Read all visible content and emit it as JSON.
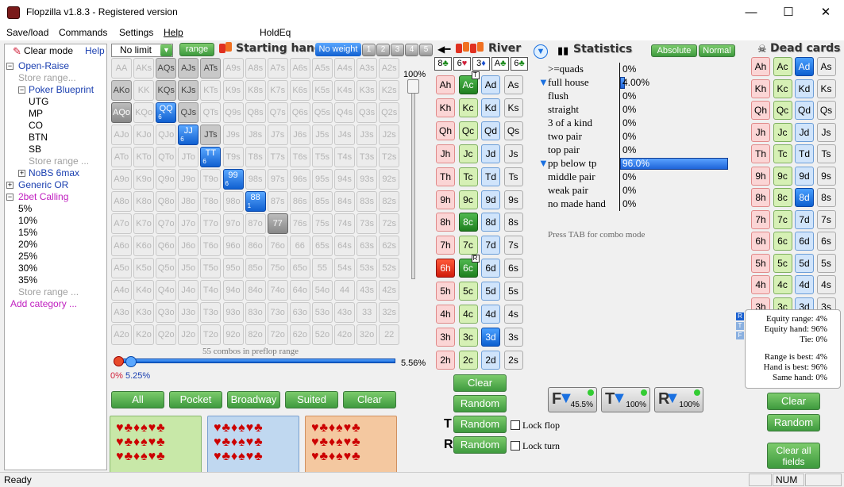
{
  "window": {
    "title": "Flopzilla v1.8.3 - Registered version",
    "minimize": "—",
    "maximize": "☐",
    "close": "✕"
  },
  "menu": [
    "Save/load",
    "Commands",
    "Settings",
    "Help",
    "HoldEq"
  ],
  "tree": {
    "clear_mode": "Clear mode",
    "help": "Help",
    "open_raise": "Open-Raise",
    "store_range": "Store range...",
    "poker_blueprint": "Poker Blueprint",
    "positions": [
      "UTG",
      "MP",
      "CO",
      "BTN",
      "SB"
    ],
    "store_range_2": "Store range ...",
    "nobs": "NoBS 6max",
    "generic_or": "Generic OR",
    "bet_calling": "2bet Calling",
    "percents": [
      "5%",
      "10%",
      "15%",
      "20%",
      "25%",
      "30%",
      "35%"
    ],
    "store_range_3": "Store range ...",
    "add_category": "Add category ..."
  },
  "range_controls": {
    "limit": "No limit",
    "range_btn": "range",
    "starting_hand": "Starting hand",
    "no_weight": "No weight",
    "weights": [
      "1",
      "2",
      "3",
      "4",
      "5"
    ],
    "slider_top": "100%",
    "combos_text": "55 combos in preflop range",
    "pct_low": "0%",
    "pct_mid": "5.25%",
    "pct_right": "5.56%",
    "buttons": [
      "All",
      "Pocket",
      "Broadway",
      "Suited",
      "Clear"
    ]
  },
  "hand_grid": [
    [
      "AA",
      "AKs",
      "AQs",
      "AJs",
      "ATs",
      "A9s",
      "A8s",
      "A7s",
      "A6s",
      "A5s",
      "A4s",
      "A3s",
      "A2s"
    ],
    [
      "AKo",
      "KK",
      "KQs",
      "KJs",
      "KTs",
      "K9s",
      "K8s",
      "K7s",
      "K6s",
      "K5s",
      "K4s",
      "K3s",
      "K2s"
    ],
    [
      "AQo",
      "KQo",
      "QQ",
      "QJs",
      "QTs",
      "Q9s",
      "Q8s",
      "Q7s",
      "Q6s",
      "Q5s",
      "Q4s",
      "Q3s",
      "Q2s"
    ],
    [
      "AJo",
      "KJo",
      "QJo",
      "JJ",
      "JTs",
      "J9s",
      "J8s",
      "J7s",
      "J6s",
      "J5s",
      "J4s",
      "J3s",
      "J2s"
    ],
    [
      "ATo",
      "KTo",
      "QTo",
      "JTo",
      "TT",
      "T9s",
      "T8s",
      "T7s",
      "T6s",
      "T5s",
      "T4s",
      "T3s",
      "T2s"
    ],
    [
      "A9o",
      "K9o",
      "Q9o",
      "J9o",
      "T9o",
      "99",
      "98s",
      "97s",
      "96s",
      "95s",
      "94s",
      "93s",
      "92s"
    ],
    [
      "A8o",
      "K8o",
      "Q8o",
      "J8o",
      "T8o",
      "98o",
      "88",
      "87s",
      "86s",
      "85s",
      "84s",
      "83s",
      "82s"
    ],
    [
      "A7o",
      "K7o",
      "Q7o",
      "J7o",
      "T7o",
      "97o",
      "87o",
      "77",
      "76s",
      "75s",
      "74s",
      "73s",
      "72s"
    ],
    [
      "A6o",
      "K6o",
      "Q6o",
      "J6o",
      "T6o",
      "96o",
      "86o",
      "76o",
      "66",
      "65s",
      "64s",
      "63s",
      "62s"
    ],
    [
      "A5o",
      "K5o",
      "Q5o",
      "J5o",
      "T5o",
      "95o",
      "85o",
      "75o",
      "65o",
      "55",
      "54s",
      "53s",
      "52s"
    ],
    [
      "A4o",
      "K4o",
      "Q4o",
      "J4o",
      "T4o",
      "94o",
      "84o",
      "74o",
      "64o",
      "54o",
      "44",
      "43s",
      "42s"
    ],
    [
      "A3o",
      "K3o",
      "Q3o",
      "J3o",
      "T3o",
      "93o",
      "83o",
      "73o",
      "63o",
      "53o",
      "43o",
      "33",
      "32s"
    ],
    [
      "A2o",
      "K2o",
      "Q2o",
      "J2o",
      "T2o",
      "92o",
      "82o",
      "72o",
      "62o",
      "52o",
      "42o",
      "32o",
      "22"
    ]
  ],
  "grid_state": {
    "selected": [
      "AQs",
      "AJs",
      "ATs",
      "KQs",
      "KJs",
      "AKo",
      "QJs",
      "JTs"
    ],
    "gray": [
      "AQo",
      "77"
    ],
    "blue": {
      "QQ": "6",
      "JJ": "6",
      "TT": "6",
      "99": "6",
      "88": "1"
    }
  },
  "board": {
    "river_label": "River",
    "filter_labels": [
      "8",
      "6",
      "3",
      "A",
      "6"
    ],
    "ranks": [
      "A",
      "K",
      "Q",
      "J",
      "T",
      "9",
      "8",
      "7",
      "6",
      "5",
      "4",
      "3",
      "2"
    ],
    "suits": [
      "h",
      "c",
      "d",
      "s"
    ],
    "active": {
      "Ac": "T",
      "8c": "",
      "6h": "",
      "6c": "R",
      "3d": ""
    },
    "clear": "Clear",
    "random_flop": "Random",
    "t_label": "T",
    "random_turn": "Random",
    "r_label": "R",
    "random_river": "Random",
    "lock_flop": "Lock flop",
    "lock_turn": "Lock turn"
  },
  "stats": {
    "title": "Statistics",
    "absolute": "Absolute",
    "normal": "Normal",
    "rows": [
      {
        "label": ">=quads",
        "value": "0%",
        "fill": 0
      },
      {
        "label": "full house",
        "value": "4.00%",
        "fill": 0.04
      },
      {
        "label": "flush",
        "value": "0%",
        "fill": 0
      },
      {
        "label": "straight",
        "value": "0%",
        "fill": 0
      },
      {
        "label": "3 of a kind",
        "value": "0%",
        "fill": 0
      },
      {
        "label": "two pair",
        "value": "0%",
        "fill": 0
      },
      {
        "label": "top pair",
        "value": "0%",
        "fill": 0
      },
      {
        "label": "pp below tp",
        "value": "96.0%",
        "fill": 0.96
      },
      {
        "label": "middle pair",
        "value": "0%",
        "fill": 0
      },
      {
        "label": "weak pair",
        "value": "0%",
        "fill": 0
      },
      {
        "label": "no made hand",
        "value": "0%",
        "fill": 0
      }
    ],
    "hint": "Press TAB for combo mode",
    "filters": [
      {
        "label": "F",
        "value": "45.5%"
      },
      {
        "label": "T",
        "value": "100%"
      },
      {
        "label": "R",
        "value": "100%"
      }
    ]
  },
  "dead": {
    "title": "Dead cards",
    "active": [
      "Ad",
      "8d"
    ],
    "clear": "Clear",
    "random": "Random",
    "clear_all": "Clear all fields"
  },
  "equity": {
    "rtf": [
      "R",
      "T",
      "F"
    ],
    "range": "Equity range: 4%",
    "hand": "Equity hand: 96%",
    "tie": "Tie: 0%",
    "range_best": "Range is best: 4%",
    "hand_best": "Hand is best: 96%",
    "same_hand": "Same hand: 0%"
  },
  "status": {
    "ready": "Ready",
    "num": "NUM"
  },
  "colors": {
    "green": "#3e9a3e",
    "blue": "#1060d0",
    "red": "#d01c0c"
  }
}
